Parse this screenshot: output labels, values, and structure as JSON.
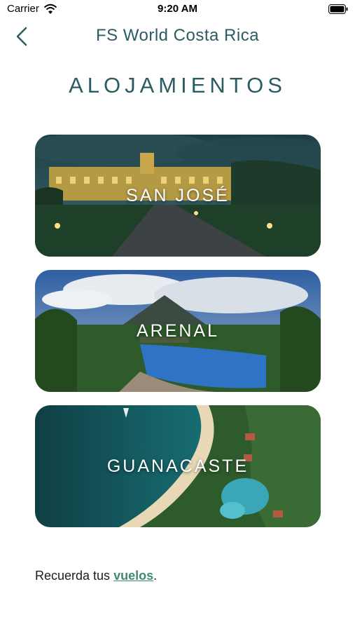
{
  "status_bar": {
    "carrier": "Carrier",
    "time": "9:20 AM"
  },
  "nav": {
    "title": "FS World Costa Rica",
    "back_icon": "chevron-left-icon"
  },
  "section": {
    "title": "ALOJAMIENTOS"
  },
  "destinations": [
    {
      "label": "SAN JOSÉ"
    },
    {
      "label": "ARENAL"
    },
    {
      "label": "GUANACASTE"
    }
  ],
  "footer": {
    "text_before": "Recuerda tus ",
    "link": "vuelos",
    "text_after": "."
  },
  "colors": {
    "accent": "#2b5c62",
    "link": "#3f8a72"
  }
}
